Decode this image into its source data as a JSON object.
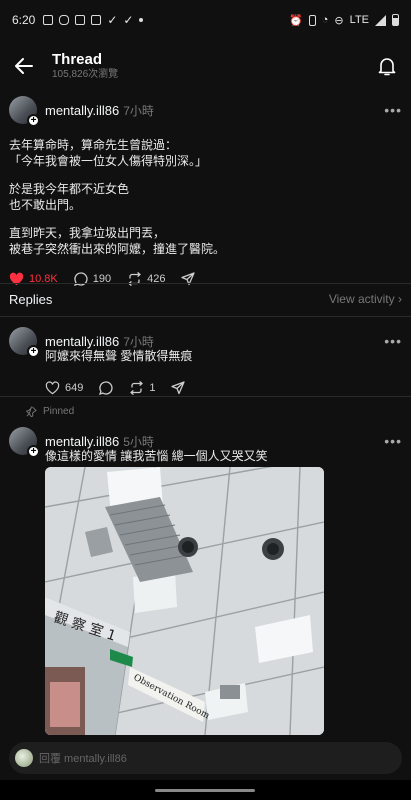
{
  "status_bar": {
    "time": "6:20",
    "network": "LTE"
  },
  "header": {
    "title": "Thread",
    "subtitle": "105,826次瀏覽"
  },
  "main_post": {
    "username": "mentally.ill86",
    "time": "7小時",
    "paragraphs": [
      "去年算命時，算命先生曾說過：\n「今年我會被一位女人傷得特別深。」",
      "於是我今年都不近女色\n也不敢出門。",
      "直到昨天，我拿垃圾出門丟，\n被巷子突然衝出來的阿嬤，撞進了醫院。"
    ],
    "likes": "10.8K",
    "comments": "190",
    "reposts": "426"
  },
  "replies_bar": {
    "label": "Replies",
    "view_activity": "View activity"
  },
  "reply1": {
    "username": "mentally.ill86",
    "time": "7小時",
    "text": "阿嬤來得無聲 愛情散得無痕",
    "likes": "649",
    "reposts": "1"
  },
  "pinned_label": "Pinned",
  "reply2": {
    "username": "mentally.ill86",
    "time": "5小時",
    "text": "像這樣的愛情 讓我苦惱 總一個人又哭又笑",
    "photo_sign_text": "觀 察 室 1",
    "photo_sign_text2": "Observation Room"
  },
  "reply_box": {
    "placeholder": "回覆 mentally.ill86"
  },
  "colors": {
    "background": "#101010",
    "like_red": "#ff3040",
    "muted": "#777777"
  }
}
